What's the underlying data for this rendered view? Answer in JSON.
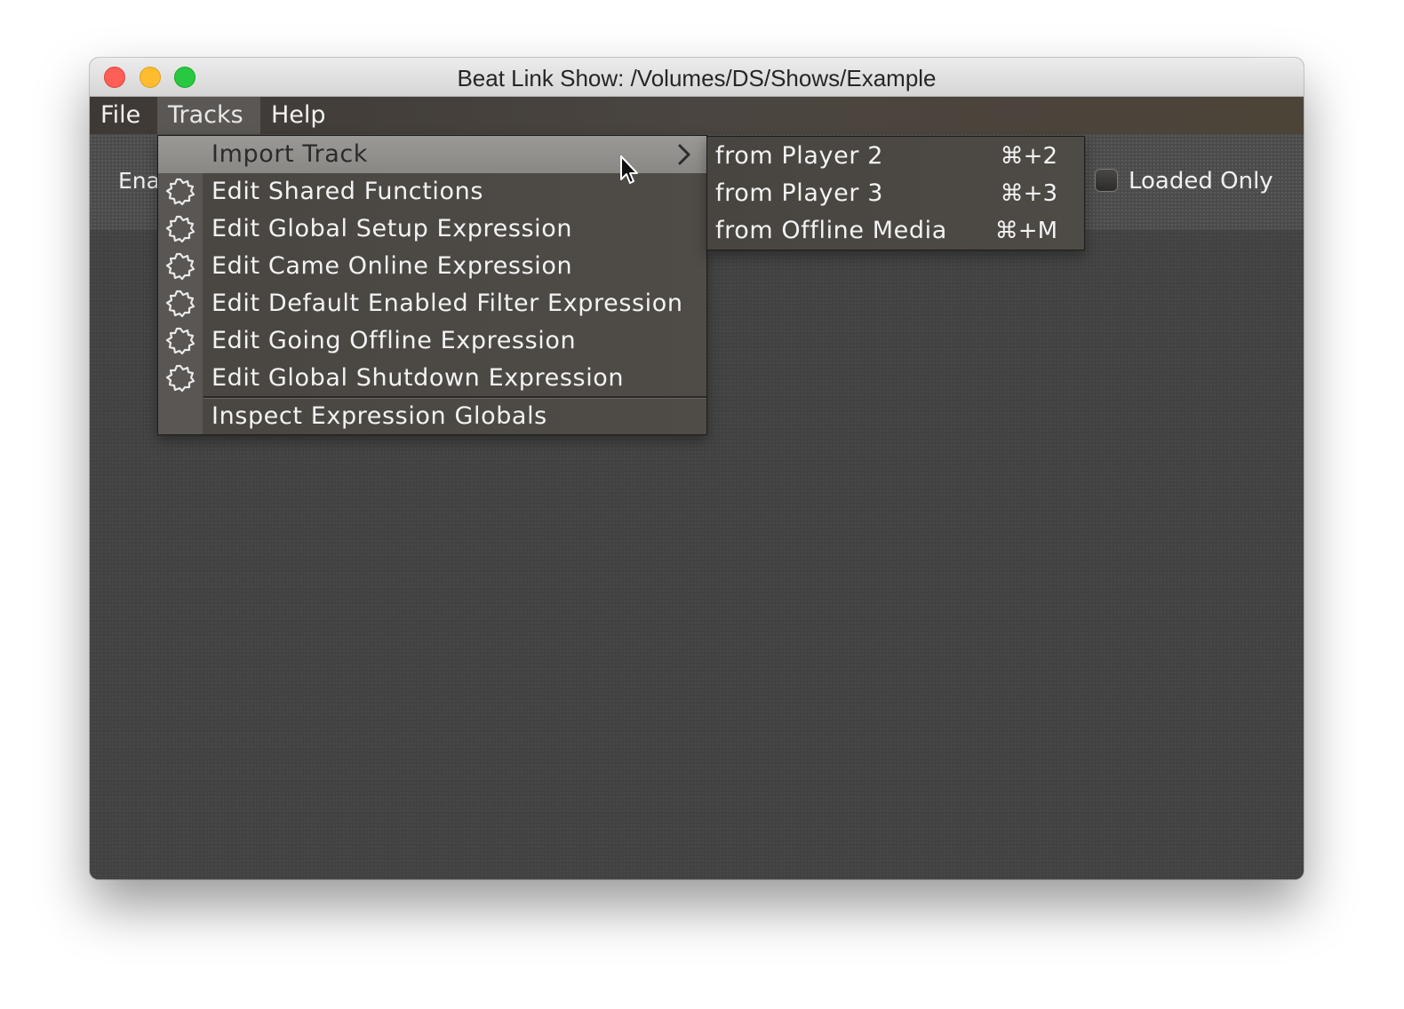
{
  "window": {
    "title": "Beat Link Show: /Volumes/DS/Shows/Example"
  },
  "menubar": {
    "file": "File",
    "tracks": "Tracks",
    "help": "Help"
  },
  "toolbar": {
    "enabled_label_partial": "Ena",
    "loaded_only_label": "Loaded Only",
    "loaded_only_checked": false
  },
  "tracks_menu": {
    "items": [
      {
        "label": "Import Track",
        "icon": "none",
        "has_submenu": true,
        "highlighted": true
      },
      {
        "label": "Edit Shared Functions",
        "icon": "gear-icon"
      },
      {
        "label": "Edit Global Setup Expression",
        "icon": "gear-icon"
      },
      {
        "label": "Edit Came Online Expression",
        "icon": "gear-icon"
      },
      {
        "label": "Edit Default Enabled Filter Expression",
        "icon": "gear-icon"
      },
      {
        "label": "Edit Going Offline Expression",
        "icon": "gear-icon"
      },
      {
        "label": "Edit Global Shutdown Expression",
        "icon": "gear-icon"
      },
      {
        "label": "Inspect Expression Globals",
        "icon": "none"
      }
    ]
  },
  "import_submenu": {
    "items": [
      {
        "label": "from Player 2",
        "shortcut": "⌘+2"
      },
      {
        "label": "from Player 3",
        "shortcut": "⌘+3"
      },
      {
        "label": "from Offline Media",
        "shortcut": "⌘+M"
      }
    ]
  },
  "colors": {
    "highlight": "#8f8d8a",
    "menu_background": "#4d4945",
    "content_background": "#424242"
  }
}
